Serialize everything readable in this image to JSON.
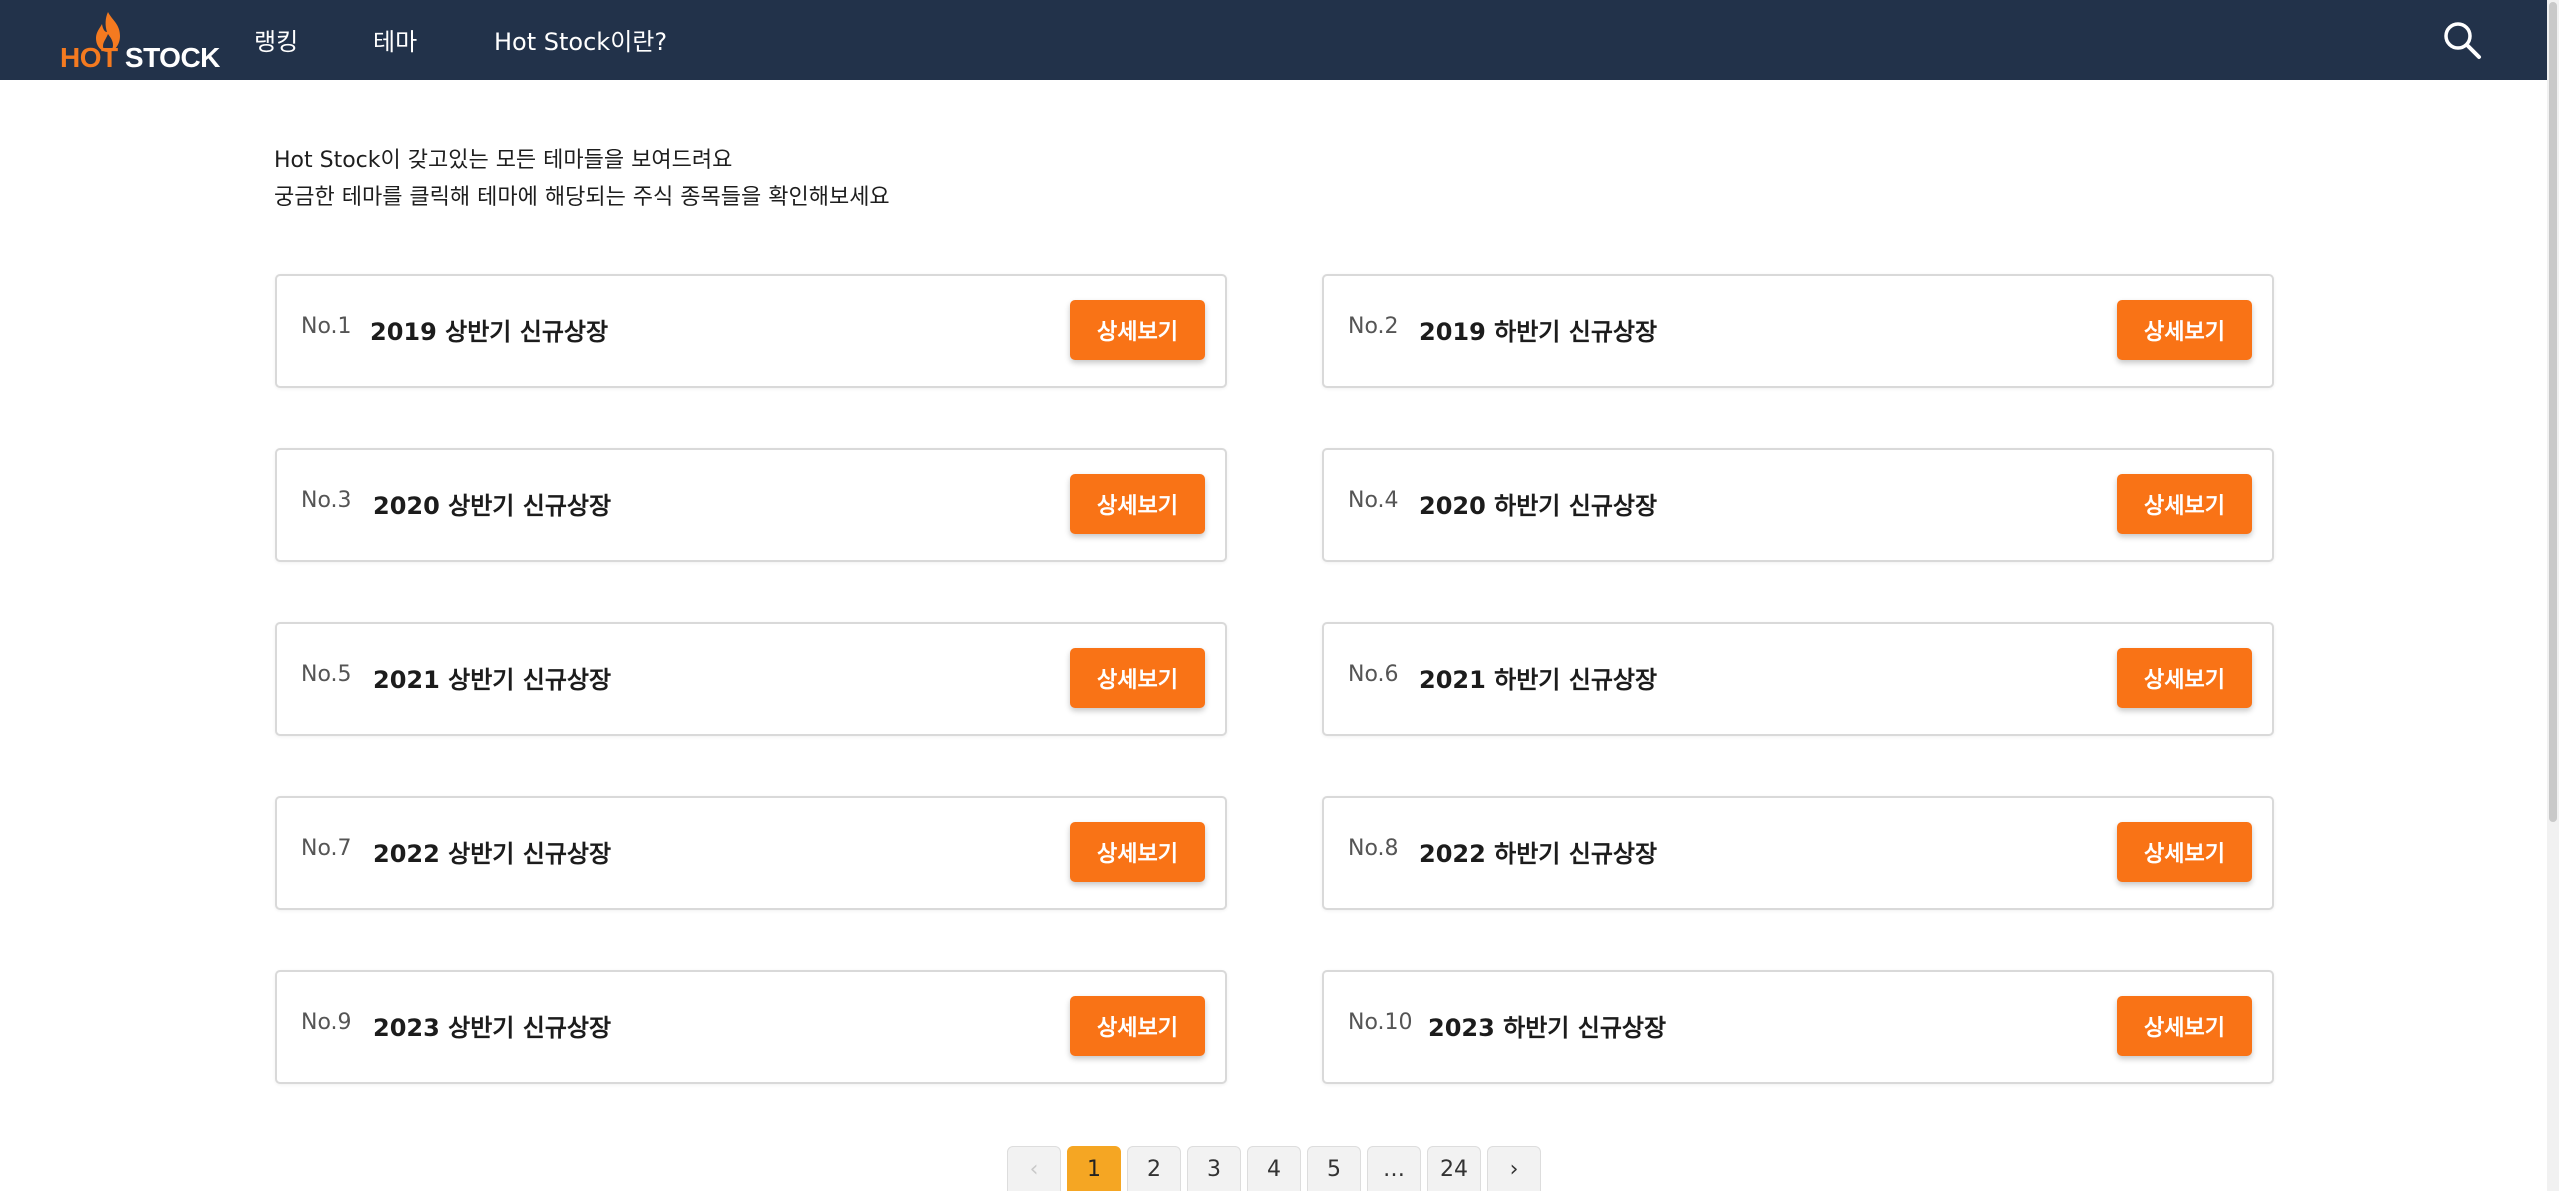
{
  "brand": {
    "logo_hot": "HOT",
    "logo_stock": "STOCK"
  },
  "nav": {
    "items": [
      {
        "label": "랭킹"
      },
      {
        "label": "테마"
      },
      {
        "label": "Hot Stock이란?"
      }
    ],
    "search_icon": "search-icon"
  },
  "intro": {
    "line1": "Hot Stock이 갖고있는 모든 테마들을 보여드려요",
    "line2": "궁금한 테마를 클릭해 테마에 해당되는 주식 종목들을 확인해보세요"
  },
  "themes": [
    {
      "no": "No.1",
      "title": "2019 상반기 신규상장",
      "button": "상세보기"
    },
    {
      "no": "No.2",
      "title": "2019 하반기 신규상장",
      "button": "상세보기"
    },
    {
      "no": "No.3",
      "title": "2020 상반기 신규상장",
      "button": "상세보기"
    },
    {
      "no": "No.4",
      "title": "2020 하반기 신규상장",
      "button": "상세보기"
    },
    {
      "no": "No.5",
      "title": "2021 상반기 신규상장",
      "button": "상세보기"
    },
    {
      "no": "No.6",
      "title": "2021 하반기 신규상장",
      "button": "상세보기"
    },
    {
      "no": "No.7",
      "title": "2022 상반기 신규상장",
      "button": "상세보기"
    },
    {
      "no": "No.8",
      "title": "2022 하반기 신규상장",
      "button": "상세보기"
    },
    {
      "no": "No.9",
      "title": "2023 상반기 신규상장",
      "button": "상세보기"
    },
    {
      "no": "No.10",
      "title": "2023 하반기 신규상장",
      "button": "상세보기"
    }
  ],
  "pagination": {
    "prev": "‹",
    "pages": [
      "1",
      "2",
      "3",
      "4",
      "5"
    ],
    "ellipsis": "…",
    "last": "24",
    "next": "›",
    "current": "1"
  },
  "colors": {
    "navbar": "#22324a",
    "accent": "#f97316",
    "active_page": "#f5a623"
  }
}
